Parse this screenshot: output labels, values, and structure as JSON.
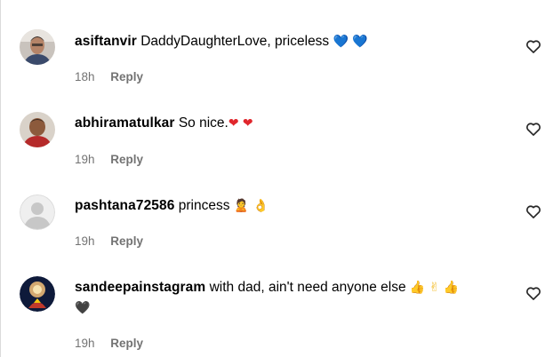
{
  "comments": [
    {
      "username": "asiftanvir",
      "text": "DaddyDaughterLove, priceless",
      "emojis": [
        "💙",
        "💙"
      ],
      "time": "18h",
      "reply_label": "Reply"
    },
    {
      "username": "abhiramatulkar",
      "text": "So nice.",
      "emojis": [
        "❤",
        "❤"
      ],
      "time": "19h",
      "reply_label": "Reply"
    },
    {
      "username": "pashtana72586",
      "text": "princess",
      "emojis": [
        "🙎",
        "👌"
      ],
      "time": "19h",
      "reply_label": "Reply"
    },
    {
      "username": "sandeepainstagram",
      "text": "with dad, ain't need anyone else",
      "emojis": [
        "👍",
        "✌",
        "👍"
      ],
      "emojis_line2": [
        "🖤"
      ],
      "time": "19h",
      "reply_label": "Reply"
    }
  ],
  "icons": {
    "like": "heart-outline-icon"
  },
  "colors": {
    "text": "#000000",
    "meta": "#737373",
    "border": "#dbdbdb"
  }
}
